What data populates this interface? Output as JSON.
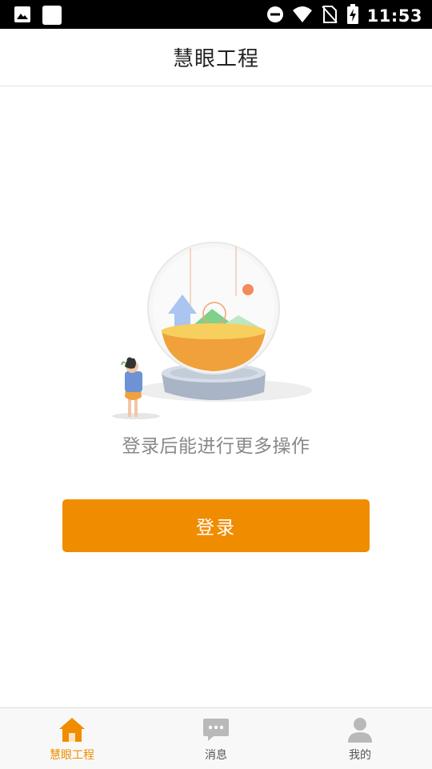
{
  "status_bar": {
    "time": "11:53",
    "icons": [
      "image-icon",
      "square-icon",
      "dnd-icon",
      "wifi-icon",
      "no-sim-icon",
      "battery-charging-icon"
    ]
  },
  "header": {
    "title": "慧眼工程"
  },
  "main": {
    "illustration": "globe-illustration",
    "empty_message": "登录后能进行更多操作",
    "login_label": "登录"
  },
  "tabs": [
    {
      "label": "慧眼工程",
      "icon": "home-icon",
      "active": true
    },
    {
      "label": "消息",
      "icon": "message-icon",
      "active": false
    },
    {
      "label": "我的",
      "icon": "person-icon",
      "active": false
    }
  ],
  "colors": {
    "accent": "#f08c00",
    "inactive_icon": "#b9b9b9"
  }
}
